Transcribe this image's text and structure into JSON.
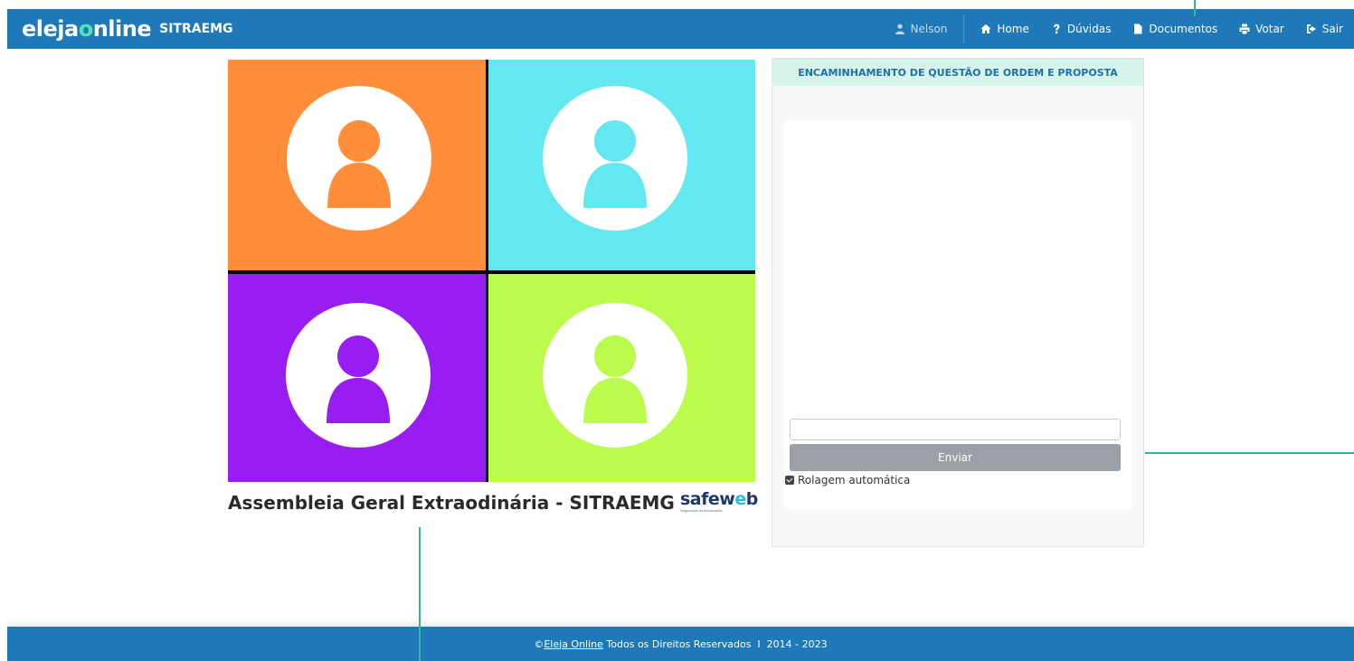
{
  "header": {
    "brand_prefix": "eleja",
    "brand_accent": "o",
    "brand_suffix": "nline",
    "org_name": "SITRAEMG",
    "background": "#1f78b7",
    "accent": "#54e3b5"
  },
  "nav": {
    "user": {
      "label": "Nelson",
      "icon": "user-icon"
    },
    "items": [
      {
        "label": "Home",
        "icon": "home-icon"
      },
      {
        "label": "Dúvidas",
        "icon": "question-icon"
      },
      {
        "label": "Documentos",
        "icon": "document-icon"
      },
      {
        "label": "Votar",
        "icon": "print-icon"
      },
      {
        "label": "Sair",
        "icon": "sign-out-icon"
      }
    ]
  },
  "video": {
    "tiles": [
      {
        "color": "#ff8d39"
      },
      {
        "color": "#63e8f0"
      },
      {
        "color": "#981df0"
      },
      {
        "color": "#bafb4c"
      }
    ]
  },
  "meeting": {
    "title": "Assembleia Geral Extraodinária - SITRAEMG",
    "partner_prefix": "safew",
    "partner_accent": "e",
    "partner_suffix": "b",
    "partner_tagline": "Segurança da Informação"
  },
  "chat": {
    "header": "ENCAMINHAMENTO DE QUESTÃO DE ORDEM E PROPOSTA",
    "input_value": "",
    "send_label": "Enviar",
    "autoscroll_label": "Rolagem automática",
    "autoscroll_checked": true
  },
  "footer": {
    "copyright_symbol": "©",
    "link_label": "Eleja Online",
    "text": " Todos os Direitos Reservados  I  2014 - 2023"
  }
}
